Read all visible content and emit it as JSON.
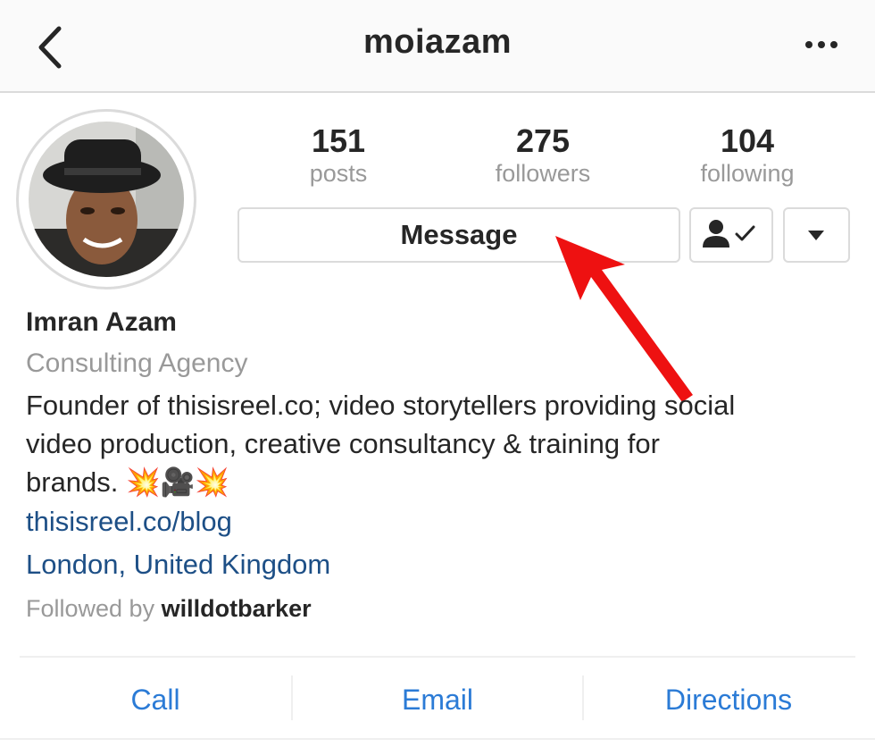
{
  "header": {
    "title": "moiazam"
  },
  "stats": [
    {
      "value": "151",
      "label": "posts"
    },
    {
      "value": "275",
      "label": "followers"
    },
    {
      "value": "104",
      "label": "following"
    }
  ],
  "actions": {
    "message_label": "Message"
  },
  "profile": {
    "name": "Imran Azam",
    "category": "Consulting Agency",
    "bio_line1": "Founder of thisisreel.co; video storytellers providing social",
    "bio_line2": "video production, creative consultancy & training for",
    "bio_line3": "brands. 💥🎥💥",
    "website": "thisisreel.co/blog",
    "location": "London, United Kingdom",
    "followed_by_prefix": "Followed by",
    "followed_by_user": "willdotbarker"
  },
  "contact": {
    "call": "Call",
    "email": "Email",
    "directions": "Directions"
  },
  "icons": {
    "back": "chevron-left-icon",
    "more": "more-horizontal-icon",
    "following": "person-check-icon",
    "dropdown": "caret-down-icon",
    "annotation": "red-arrow-icon"
  },
  "colors": {
    "link": "#1d4f86",
    "action": "#2b7bd6",
    "arrow": "#ee1111"
  }
}
